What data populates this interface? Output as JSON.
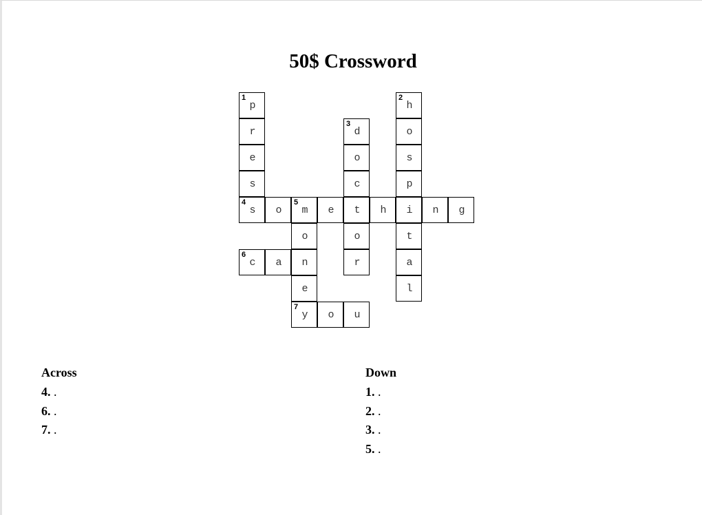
{
  "title": "50$ Crossword",
  "grid": {
    "cells": [
      {
        "r": 0,
        "c": 0,
        "ch": "p",
        "n": "1"
      },
      {
        "r": 0,
        "c": 6,
        "ch": "h",
        "n": "2"
      },
      {
        "r": 1,
        "c": 0,
        "ch": "r"
      },
      {
        "r": 1,
        "c": 4,
        "ch": "d",
        "n": "3"
      },
      {
        "r": 1,
        "c": 6,
        "ch": "o"
      },
      {
        "r": 2,
        "c": 0,
        "ch": "e"
      },
      {
        "r": 2,
        "c": 4,
        "ch": "o"
      },
      {
        "r": 2,
        "c": 6,
        "ch": "s"
      },
      {
        "r": 3,
        "c": 0,
        "ch": "s"
      },
      {
        "r": 3,
        "c": 4,
        "ch": "c"
      },
      {
        "r": 3,
        "c": 6,
        "ch": "p"
      },
      {
        "r": 4,
        "c": 0,
        "ch": "s",
        "n": "4"
      },
      {
        "r": 4,
        "c": 1,
        "ch": "o"
      },
      {
        "r": 4,
        "c": 2,
        "ch": "m",
        "n": "5"
      },
      {
        "r": 4,
        "c": 3,
        "ch": "e"
      },
      {
        "r": 4,
        "c": 4,
        "ch": "t"
      },
      {
        "r": 4,
        "c": 5,
        "ch": "h"
      },
      {
        "r": 4,
        "c": 6,
        "ch": "i"
      },
      {
        "r": 4,
        "c": 7,
        "ch": "n"
      },
      {
        "r": 4,
        "c": 8,
        "ch": "g"
      },
      {
        "r": 5,
        "c": 2,
        "ch": "o"
      },
      {
        "r": 5,
        "c": 4,
        "ch": "o"
      },
      {
        "r": 5,
        "c": 6,
        "ch": "t"
      },
      {
        "r": 6,
        "c": 0,
        "ch": "c",
        "n": "6"
      },
      {
        "r": 6,
        "c": 1,
        "ch": "a"
      },
      {
        "r": 6,
        "c": 2,
        "ch": "n"
      },
      {
        "r": 6,
        "c": 4,
        "ch": "r"
      },
      {
        "r": 6,
        "c": 6,
        "ch": "a"
      },
      {
        "r": 7,
        "c": 2,
        "ch": "e"
      },
      {
        "r": 7,
        "c": 6,
        "ch": "l"
      },
      {
        "r": 8,
        "c": 2,
        "ch": "y",
        "n": "7"
      },
      {
        "r": 8,
        "c": 3,
        "ch": "o"
      },
      {
        "r": 8,
        "c": 4,
        "ch": "u"
      }
    ]
  },
  "across": {
    "heading": "Across",
    "clues": [
      {
        "num": "4.",
        "text": "."
      },
      {
        "num": "6.",
        "text": "."
      },
      {
        "num": "7.",
        "text": "."
      }
    ]
  },
  "down": {
    "heading": "Down",
    "clues": [
      {
        "num": "1.",
        "text": "."
      },
      {
        "num": "2.",
        "text": "."
      },
      {
        "num": "3.",
        "text": "."
      },
      {
        "num": "5.",
        "text": "."
      }
    ]
  }
}
